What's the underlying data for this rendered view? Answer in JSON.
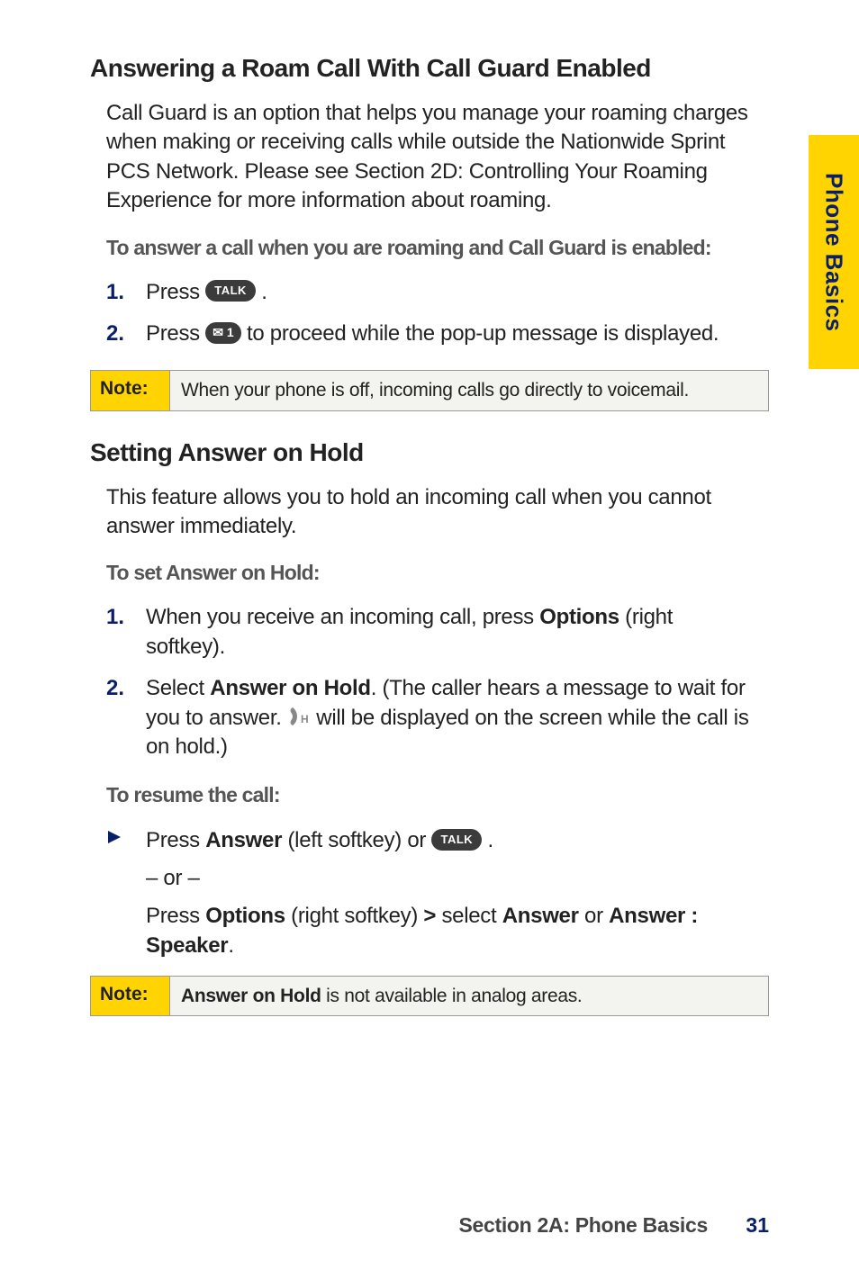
{
  "sideTab": "Phone Basics",
  "h1": "Answering a Roam Call With Call Guard Enabled",
  "p1": "Call Guard is an option that helps you manage your roaming charges when making or receiving calls while outside the Nationwide Sprint PCS Network. Please see Section 2D: Controlling Your Roaming Experience for more information about roaming.",
  "lead1": "To answer a call when you are roaming and Call Guard is enabled:",
  "steps1": {
    "n1": "1.",
    "t1a": "Press ",
    "key_talk": "TALK",
    "t1b": " .",
    "n2": "2.",
    "t2a": "Press ",
    "key_one": "✉ 1",
    "t2b": " to proceed while the pop-up message is displayed."
  },
  "note1": {
    "label": "Note:",
    "msg": "When your phone is off, incoming calls go directly to voicemail."
  },
  "h2": "Setting Answer on Hold",
  "p2": "This feature allows you to hold an incoming call when you cannot answer immediately.",
  "lead2": "To set Answer on Hold:",
  "steps2": {
    "n1": "1.",
    "t1a": "When you receive an incoming call, press ",
    "t1b": "Options",
    "t1c": " (right softkey).",
    "n2": "2.",
    "t2a": "Select ",
    "t2b": "Answer on Hold",
    "t2c": ". (The caller hears a message to wait for you to answer. ",
    "t2d": " will be displayed on the screen while the call is on hold.)"
  },
  "lead3": "To resume the call:",
  "resume": {
    "r1a": "Press ",
    "r1b": "Answer",
    "r1c": " (left softkey) or ",
    "r1d": " .",
    "or": "– or –",
    "r2a": "Press ",
    "r2b": "Options",
    "r2c": " (right softkey) ",
    "r2d": ">",
    "r2e": " select ",
    "r2f": "Answer",
    "r2g": " or ",
    "r2h": "Answer : Speaker",
    "r2i": "."
  },
  "note2": {
    "label": "Note:",
    "msg_b": "Answer on Hold",
    "msg_rest": " is not available in analog areas."
  },
  "footer": {
    "section": "Section 2A: Phone Basics",
    "page": "31"
  }
}
